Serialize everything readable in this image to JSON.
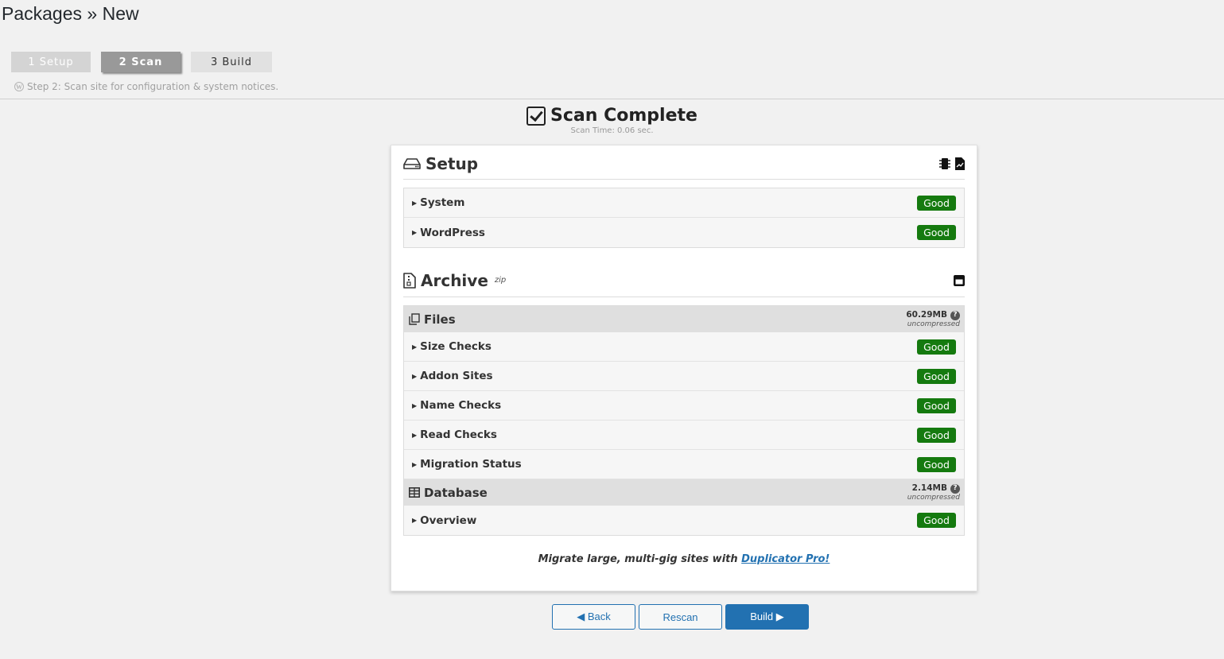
{
  "page": {
    "title": "Packages » New"
  },
  "steps": [
    {
      "label": "1 Setup"
    },
    {
      "label": "2 Scan"
    },
    {
      "label": "3 Build"
    }
  ],
  "step_note": "Step 2: Scan site for configuration & system notices.",
  "scan": {
    "title": "Scan Complete",
    "time": "Scan Time: 0.06 sec."
  },
  "setup": {
    "title": "Setup",
    "rows": [
      {
        "label": "System",
        "status": "Good"
      },
      {
        "label": "WordPress",
        "status": "Good"
      }
    ]
  },
  "archive": {
    "title": "Archive",
    "format": "zip",
    "files": {
      "title": "Files",
      "size": "60.29MB",
      "size_note": "uncompressed",
      "rows": [
        {
          "label": "Size Checks",
          "status": "Good"
        },
        {
          "label": "Addon Sites",
          "status": "Good"
        },
        {
          "label": "Name Checks",
          "status": "Good"
        },
        {
          "label": "Read Checks",
          "status": "Good"
        },
        {
          "label": "Migration Status",
          "status": "Good"
        }
      ]
    },
    "database": {
      "title": "Database",
      "size": "2.14MB",
      "size_note": "uncompressed",
      "rows": [
        {
          "label": "Overview",
          "status": "Good"
        }
      ]
    }
  },
  "promo": {
    "text": "Migrate large, multi-gig sites with ",
    "link": "Duplicator Pro!"
  },
  "buttons": {
    "back": "◀ Back",
    "rescan": "Rescan",
    "build": "Build ▶"
  },
  "colors": {
    "good": "#157a0f",
    "primary": "#2271b1"
  },
  "icons": [
    "wordpress-icon",
    "checkbox-checked-icon",
    "hard-drive-icon",
    "cpu-icon",
    "file-chart-icon",
    "file-zipper-icon",
    "save-icon",
    "copy-icon",
    "table-icon",
    "caret-right-icon",
    "help-icon"
  ]
}
